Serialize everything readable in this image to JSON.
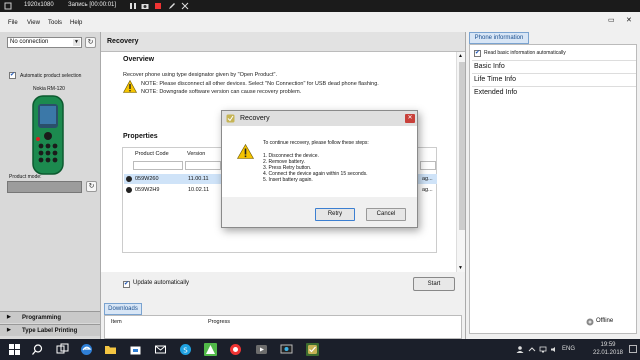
{
  "recording_bar": {
    "resolution": "1920x1080",
    "recording": "Запись [00:00:01]"
  },
  "menu": [
    "File",
    "View",
    "Tools",
    "Help"
  ],
  "left_panel": {
    "connection": "No connection",
    "auto_select_label": "Automatic product selection",
    "phone_model": "Nokia RM-120",
    "product_mode_label": "Product mode:",
    "nav": [
      "Programming",
      "Type Label Printing"
    ]
  },
  "main": {
    "header": "Recovery",
    "overview_title": "Overview",
    "overview_text": "Recover phone using type designator given by \"Open Product\".",
    "note1": "NOTE: Please disconnect all other devices. Select \"No Connection\" for USB dead phone flashing.",
    "note2": "NOTE: Downgrade software version can cause recovery problem.",
    "properties_title": "Properties",
    "columns": [
      "Product Code",
      "Version"
    ],
    "rows": [
      {
        "code": "059W260",
        "version": "11.00.11",
        "extra": "ag..."
      },
      {
        "code": "059W2H9",
        "version": "10.02.11",
        "extra": "ag..."
      }
    ],
    "update_label": "Update automatically",
    "start_label": "Start",
    "downloads_tab": "Downloads",
    "downloads_columns": [
      "Item",
      "Progress"
    ]
  },
  "right": {
    "tab": "Phone information",
    "read_basic_label": "Read basic information automatically",
    "items": [
      "Basic Info",
      "Life Time Info",
      "Extended Info"
    ]
  },
  "status": {
    "offline": "Offline"
  },
  "dialog": {
    "title": "Recovery",
    "intro": "To continue recovery, please follow these steps:",
    "steps": [
      "1. Disconnect the device.",
      "2. Remove battery.",
      "3. Press Retry button.",
      "4. Connect the device again within 15 seconds.",
      "5. Insert battery again."
    ],
    "retry": "Retry",
    "cancel": "Cancel"
  },
  "taskbar": {
    "lang": "ENG",
    "time": "19:59",
    "date": "22.01.2018"
  },
  "colors": {
    "accent": "#3c7fd1",
    "phone_body": "#1c8a4f",
    "close_red": "#c8403a"
  }
}
